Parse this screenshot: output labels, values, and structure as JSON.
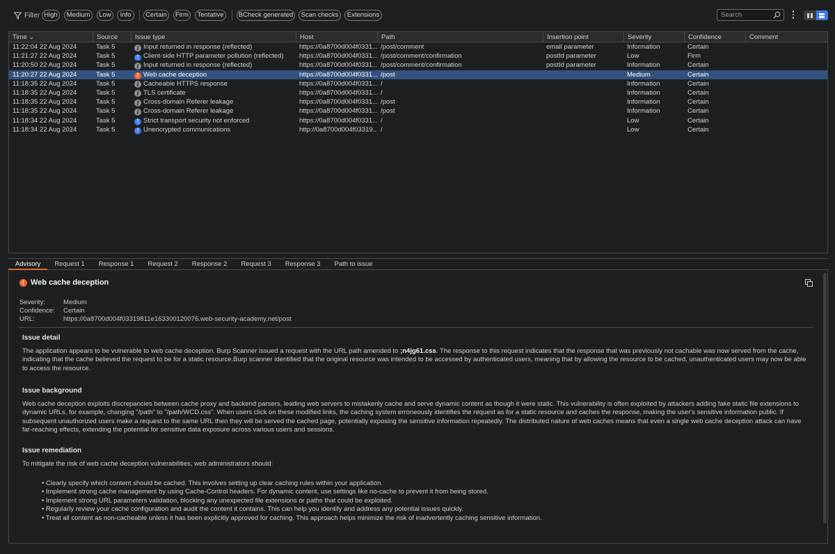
{
  "toolbar": {
    "filter_label": "Filter",
    "pills": [
      "High",
      "Medium",
      "Low",
      "Info",
      "Certain",
      "Firm",
      "Tentative",
      "BCheck generated",
      "Scan checks",
      "Extensions"
    ],
    "search_placeholder": "Search"
  },
  "table": {
    "columns": [
      "Time",
      "Source",
      "Issue type",
      "Host",
      "Path",
      "Insertion point",
      "Severity",
      "Confidence",
      "Comment"
    ],
    "sort_indicator": "⌄",
    "rows": [
      {
        "time": "11:22:04 22 Aug 2024",
        "source": "Task 5",
        "icon": "info",
        "issue": "Input returned in response (reflected)",
        "host": "https://0a8700d004f0331...",
        "path": "/post/comment",
        "insertion": "email parameter",
        "severity": "Information",
        "confidence": "Certain",
        "comment": ""
      },
      {
        "time": "11:21:27 22 Aug 2024",
        "source": "Task 5",
        "icon": "low",
        "issue": "Client-side HTTP parameter pollution (reflected)",
        "host": "https://0a8700d004f0331...",
        "path": "/post/comment/confirmation",
        "insertion": "postId parameter",
        "severity": "Low",
        "confidence": "Firm",
        "comment": ""
      },
      {
        "time": "11:20:50 22 Aug 2024",
        "source": "Task 5",
        "icon": "info",
        "issue": "Input returned in response (reflected)",
        "host": "https://0a8700d004f0331...",
        "path": "/post/comment/confirmation",
        "insertion": "postId parameter",
        "severity": "Information",
        "confidence": "Certain",
        "comment": ""
      },
      {
        "time": "11:20:27 22 Aug 2024",
        "source": "Task 5",
        "icon": "medium",
        "issue": "Web cache deception",
        "host": "https://0a8700d004f0331...",
        "path": "/post",
        "insertion": "",
        "severity": "Medium",
        "confidence": "Certain",
        "comment": "",
        "selected": true
      },
      {
        "time": "11:18:35 22 Aug 2024",
        "source": "Task 5",
        "icon": "info",
        "issue": "Cacheable HTTPS response",
        "host": "https://0a8700d004f0331...",
        "path": "/",
        "insertion": "",
        "severity": "Information",
        "confidence": "Certain",
        "comment": ""
      },
      {
        "time": "11:18:35 22 Aug 2024",
        "source": "Task 5",
        "icon": "info",
        "issue": "TLS certificate",
        "host": "https://0a8700d004f0331...",
        "path": "/",
        "insertion": "",
        "severity": "Information",
        "confidence": "Certain",
        "comment": ""
      },
      {
        "time": "11:18:35 22 Aug 2024",
        "source": "Task 5",
        "icon": "info",
        "issue": "Cross-domain Referer leakage",
        "host": "https://0a8700d004f0331...",
        "path": "/post",
        "insertion": "",
        "severity": "Information",
        "confidence": "Certain",
        "comment": ""
      },
      {
        "time": "11:18:35 22 Aug 2024",
        "source": "Task 5",
        "icon": "info",
        "issue": "Cross-domain Referer leakage",
        "host": "https://0a8700d004f0331...",
        "path": "/post",
        "insertion": "",
        "severity": "Information",
        "confidence": "Certain",
        "comment": ""
      },
      {
        "time": "11:18:34 22 Aug 2024",
        "source": "Task 5",
        "icon": "low",
        "issue": "Strict transport security not enforced",
        "host": "https://0a8700d004f0331...",
        "path": "/",
        "insertion": "",
        "severity": "Low",
        "confidence": "Certain",
        "comment": ""
      },
      {
        "time": "11:18:34 22 Aug 2024",
        "source": "Task 5",
        "icon": "low",
        "issue": "Unencrypted communications",
        "host": "http://0a8700d004f03319...",
        "path": "/",
        "insertion": "",
        "severity": "Low",
        "confidence": "Certain",
        "comment": ""
      }
    ]
  },
  "tabs": [
    "Advisory",
    "Request 1",
    "Response 1",
    "Request 2",
    "Response 2",
    "Request 3",
    "Response 3",
    "Path to issue"
  ],
  "advisory": {
    "title": "Web cache deception",
    "severity_label": "Severity:",
    "severity": "Medium",
    "confidence_label": "Confidence:",
    "confidence": "Certain",
    "url_label": "URL:",
    "url": "https://0a8700d004f03319811e163300120076.web-security-academy.net/post",
    "detail_heading": "Issue detail",
    "detail_part1": "The application appears to be vulnerable to web cache deception. Burp Scanner issued a request with the URL path amended to ",
    "detail_bold": ";n4jg61.css",
    "detail_part2": ". The response to this request indicates that the response that was previously not cachable was now served from the cache, indicating that the cache believed the request to be for a static resource.Burp scanner identified that the original resource was intended to be accessed by authenticated users, meaning that by allowing the resource to be cached, unauthenticated users may now be able to access the resource.",
    "background_heading": "Issue background",
    "background": "Web cache deception exploits discrepancies between cache proxy and backend parsers, leading web servers to mistakenly cache and serve dynamic content as though it were static. This vulnerability is often exploited by attackers adding fake static file extensions to dynamic URLs, for example, changing \"/path\" to \"/path/WCD.css\". When users click on these modified links, the caching system erroneously identifies the request as for a static resource and caches the response, making the user's sensitive information public. If subsequent unauthorized users make a request to the same URL then they will be served the cached page, potentially exposing the sensitive information repeatedly. The distributed nature of web caches means that even a single web cache deception attack can have far-reaching effects, extending the potential for sensitive data exposure across various users and sessions.",
    "remediation_heading": "Issue remediation",
    "remediation_intro": "To mitigate the risk of web cache deception vulnerabilities, web administrators should:",
    "remediation_items": [
      "Clearly specify which content should be cached. This involves setting up clear caching rules within your application.",
      "Implement strong cache management by using Cache-Control headers. For dynamic content, use settings like no-cache to prevent it from being stored.",
      "Implement strong URL parameters validation, blocking any unexpected file extensions or paths that could be exploited.",
      "Regularly review your cache configuration and audit the content it contains. This can help you identify and address any potential issues quickly.",
      "Treat all content as non-cacheable unless it has been explicitly approved for caching. This approach helps minimize the risk of inadvertently caching sensitive information."
    ]
  },
  "colors": {
    "selected_row": "#33527e",
    "accent_tab": "#e06a30",
    "severity_medium": "#f06a37",
    "severity_low": "#3d7de8",
    "severity_info": "#8d8f93"
  }
}
